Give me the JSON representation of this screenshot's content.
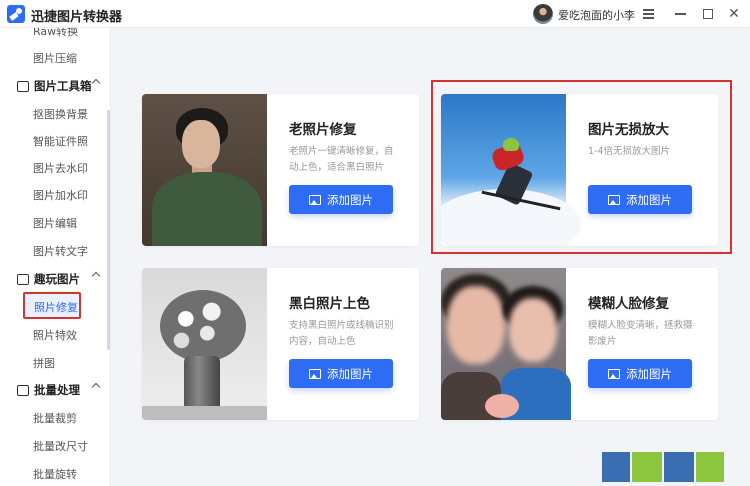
{
  "app": {
    "title": "迅捷图片转换器"
  },
  "user": {
    "name": "爱吃泡面的小李"
  },
  "window_controls": [
    "menu-icon",
    "minimize-icon",
    "maximize-icon",
    "close-icon"
  ],
  "sidebar": {
    "items_top": [
      {
        "label": "Raw转换",
        "partial": true
      },
      {
        "label": "图片压缩"
      }
    ],
    "groups": [
      {
        "label": "图片工具箱",
        "icon": "toolbox-icon",
        "items": [
          "抠图换背景",
          "智能证件照",
          "图片去水印",
          "图片加水印",
          "图片编辑",
          "图片转文字"
        ]
      },
      {
        "label": "趣玩图片",
        "icon": "image-icon",
        "items": [
          "照片修复",
          "照片特效",
          "拼图"
        ]
      },
      {
        "label": "批量处理",
        "icon": "batch-icon",
        "items": [
          "批量裁剪",
          "批量改尺寸",
          "批量旋转"
        ]
      }
    ],
    "active_item": "照片修复"
  },
  "cards": [
    {
      "title": "老照片修复",
      "desc": "老照片一键清晰修复，自动上色，适合黑白照片",
      "button": "添加图片"
    },
    {
      "title": "图片无损放大",
      "desc": "1-4倍无损放大图片",
      "button": "添加图片",
      "highlighted": true
    },
    {
      "title": "黑白照片上色",
      "desc": "支持黑白照片或线稿识别内容，自动上色",
      "button": "添加图片"
    },
    {
      "title": "模糊人脸修复",
      "desc": "模糊人脸变清晰，拯救摄影废片",
      "button": "添加图片"
    }
  ],
  "colors": {
    "accent": "#2f6cf5",
    "highlight_border": "#d6332e",
    "background": "#f2f4f8"
  }
}
